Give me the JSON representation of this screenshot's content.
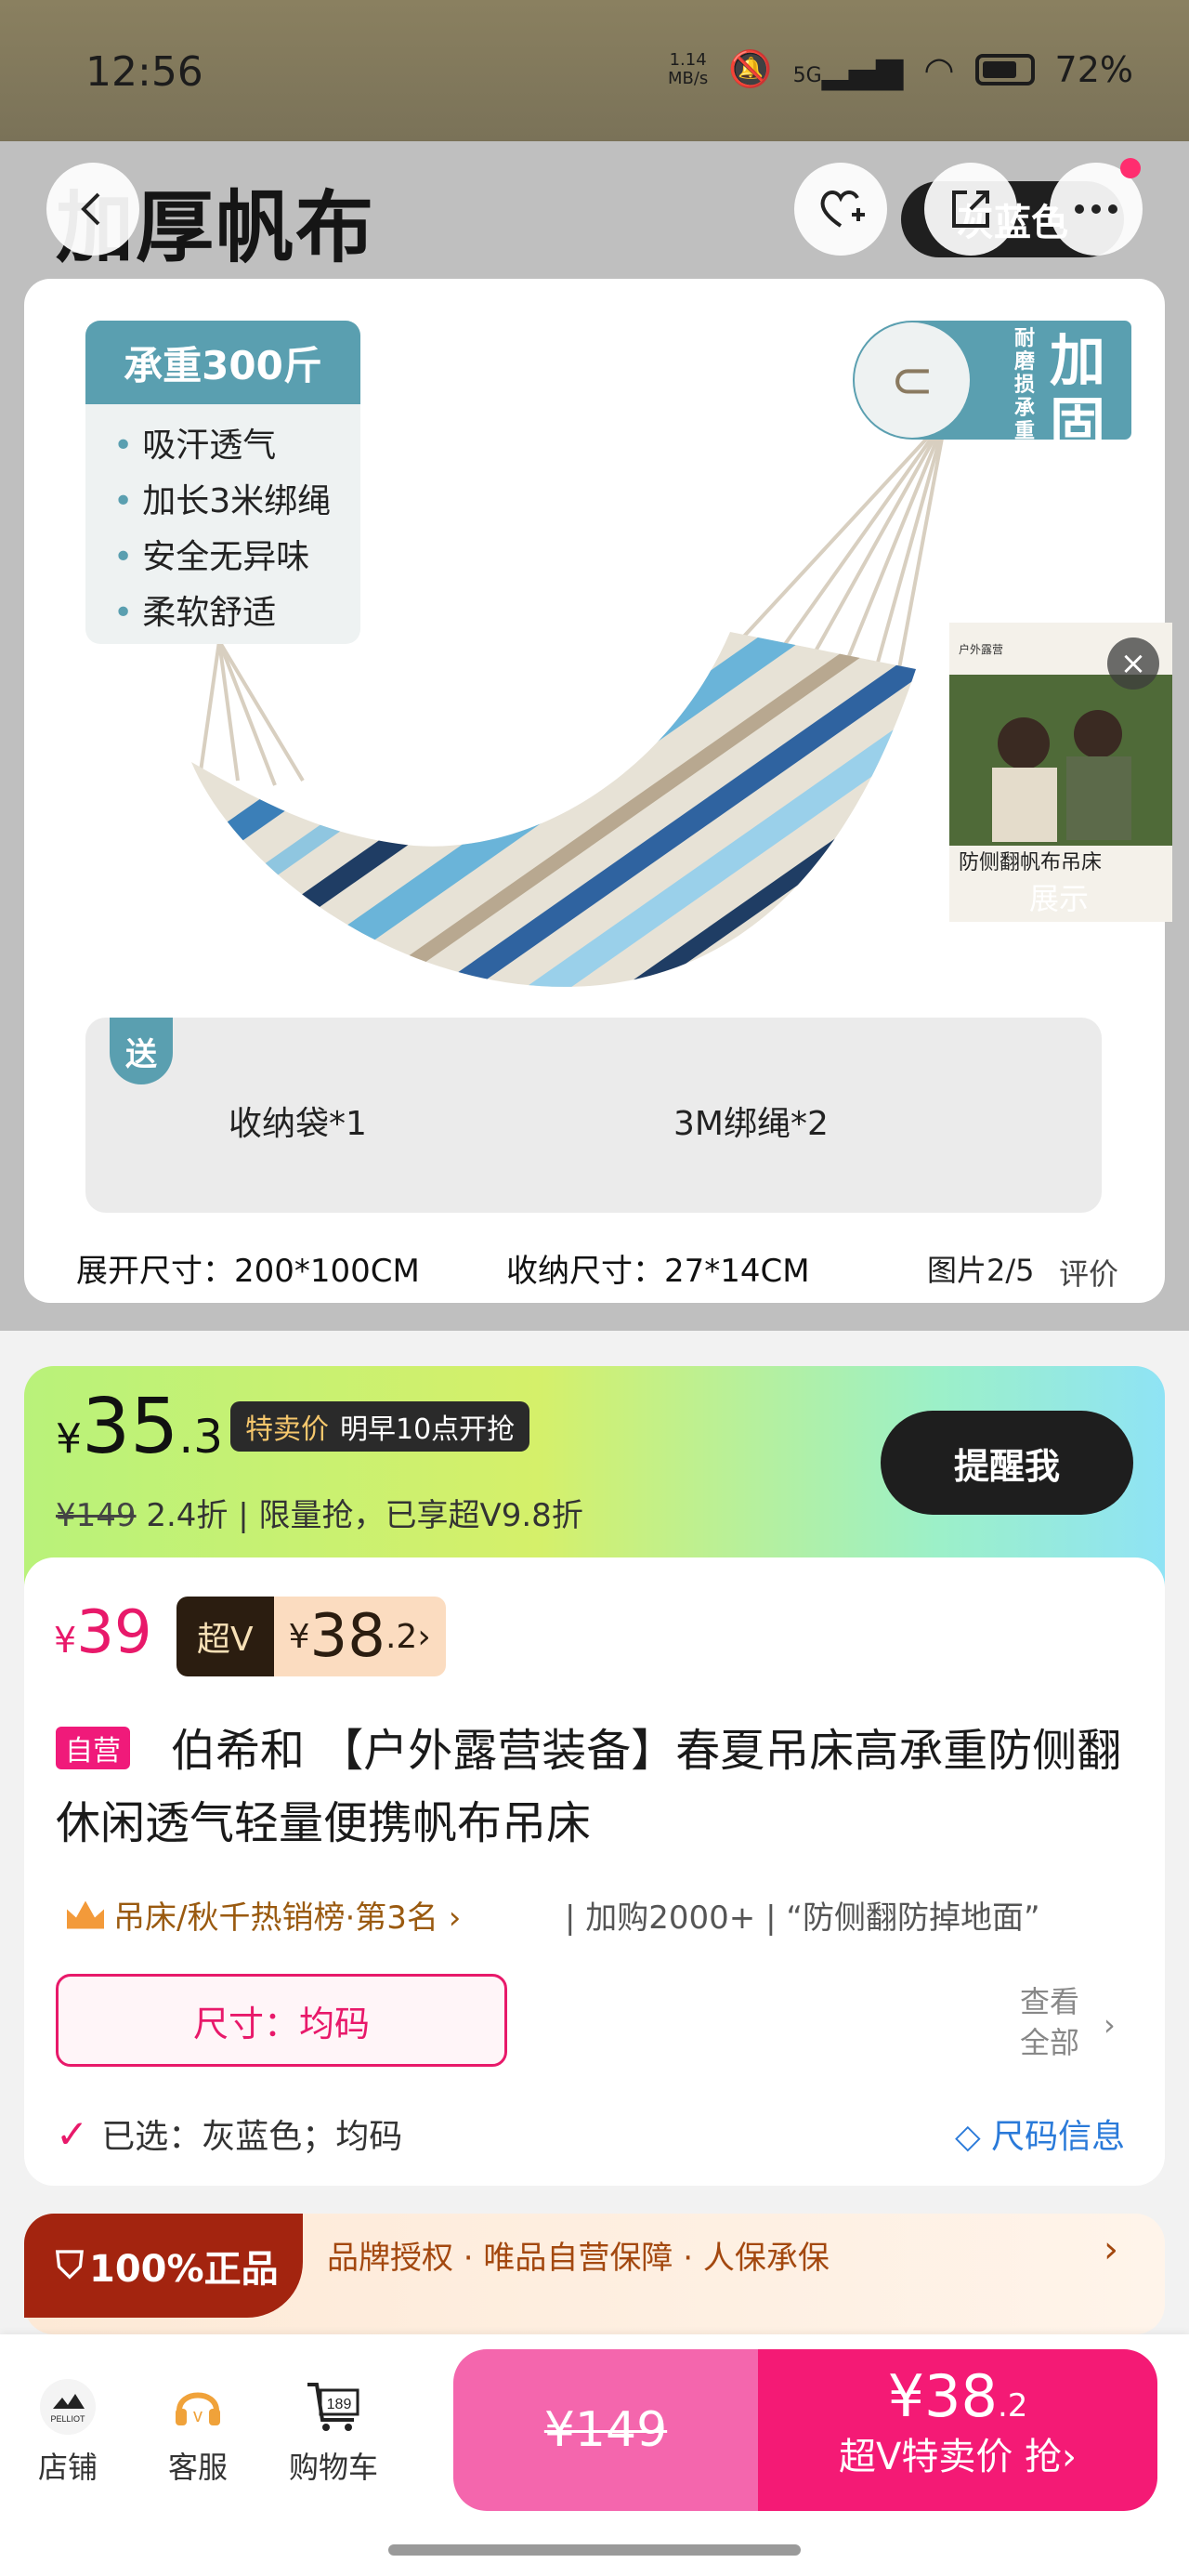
{
  "status": {
    "time": "12:56",
    "speed_top": "1.14",
    "speed_unit": "MB/s",
    "network": "5G",
    "battery": "72%"
  },
  "header": {
    "title": "加厚帆布",
    "color_chip": "灰蓝色"
  },
  "gallery": {
    "spec_title": "承重300斤",
    "spec_items": [
      "吸汗透气",
      "加长3米绑绳",
      "安全无异味",
      "柔软舒适"
    ],
    "badge_small": "耐磨损承重强",
    "badge_big": "加固",
    "gift_tag": "送",
    "gift_1": "收纳袋*1",
    "gift_2": "3M绑绳*2",
    "dims_open": "展开尺寸：200*100CM",
    "dims_pack": "收纳尺寸：27*14CM",
    "image_counter": "图片2/5",
    "review_tab": "评价",
    "mini_video_brand": "户外露营",
    "mini_video_caption": "防侧翻帆布吊床",
    "mini_video_label": "展示"
  },
  "price": {
    "currency": "¥",
    "sale_int": "35",
    "sale_dec": ".3",
    "sale_tag": "特卖价",
    "sale_time": "明早10点开抢",
    "remind_button": "提醒我",
    "original": "¥149",
    "discount_text": "2.4折 | 限量抢，已享超V9.8折",
    "normal_price": "39",
    "v_label": "超V",
    "v_price_int": "38",
    "v_price_dec": ".2"
  },
  "product": {
    "self_tag": "自营",
    "title": "伯希和 【户外露营装备】春夏吊床高承重防侧翻休闲透气轻量便携帆布吊床",
    "rank": "吊床/秋千热销榜·第3名 ›",
    "extra": "| 加购2000+ | “防侧翻防掉地面”",
    "size_button": "尺寸：均码",
    "see_all": "查看全部",
    "selected": "已选：灰蓝色；均码",
    "size_info": "尺码信息"
  },
  "guarantee": {
    "badge": "100%正品",
    "text": "品牌授权 · 唯品自营保障 · 人保承保"
  },
  "bottom": {
    "store": "店铺",
    "store_logo": "PELLIOT",
    "service": "客服",
    "cart": "购物车",
    "cart_count": "189",
    "original_price": "¥149",
    "buy_price_int": "¥38",
    "buy_price_dec": ".2",
    "buy_label": "超V特卖价 抢›"
  }
}
